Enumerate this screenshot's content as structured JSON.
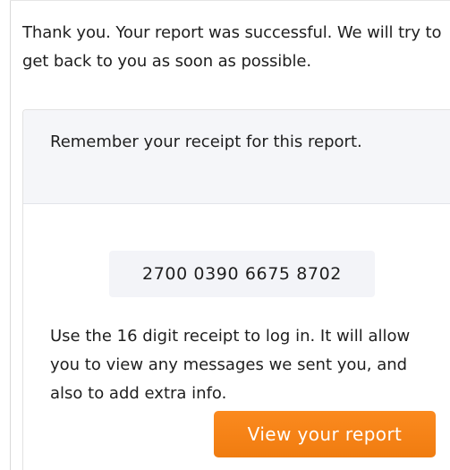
{
  "intro": {
    "text": "Thank you. Your report was successful. We will try to get back to you as soon as possible."
  },
  "receipt_card": {
    "header_text": "Remember your receipt for this report.",
    "receipt_number": "2700 0390 6675 8702",
    "info_text": "Use the 16 digit receipt to log in. It will allow you to view any messages we sent you, and also to add extra info.",
    "button_label": "View your report"
  },
  "colors": {
    "accent": "#f57f17",
    "header_bg": "#f5f6f9",
    "receipt_bg": "#f3f4f8",
    "text": "#1e1e1e"
  }
}
